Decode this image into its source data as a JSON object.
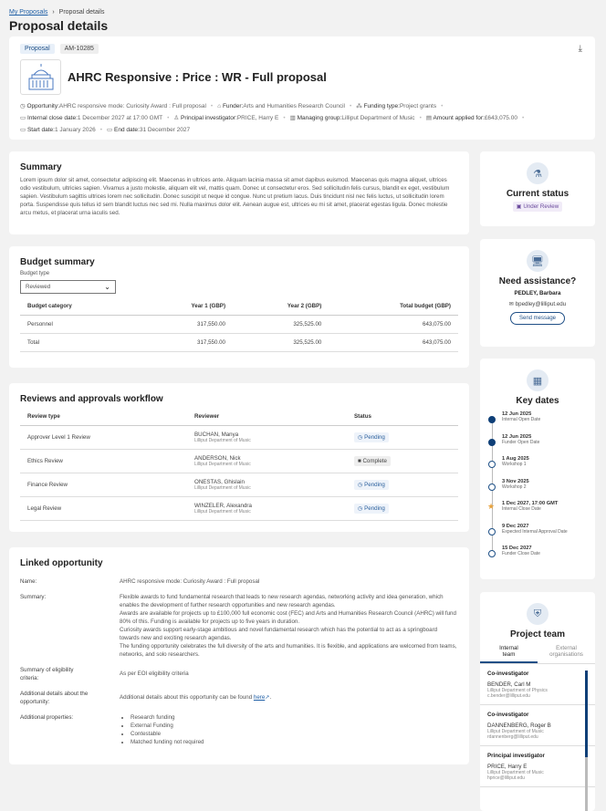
{
  "breadcrumb": {
    "link": "My Proposals",
    "sep": "›",
    "current": "Proposal details"
  },
  "page_title": "Proposal details",
  "header": {
    "type_chip": "Proposal",
    "id_chip": "AM-10285",
    "title": "AHRC Responsive : Price : WR - Full proposal",
    "meta": [
      {
        "icon": "clock-icon",
        "label": "Opportunity:",
        "value": "AHRC responsive mode: Curiosity Award : Full proposal"
      },
      {
        "icon": "bank-icon",
        "label": "Funder:",
        "value": "Arts and Humanities Research Council"
      },
      {
        "icon": "sitemap-icon",
        "label": "Funding type:",
        "value": "Project grants"
      },
      {
        "icon": "calendar-icon",
        "label": "Internal close date:",
        "value": "1 December 2027 at 17:00 GMT"
      },
      {
        "icon": "person-icon",
        "label": "Principal investigator:",
        "value": "PRICE, Harry E"
      },
      {
        "icon": "building-icon",
        "label": "Managing group:",
        "value": "Lilliput Department of Music"
      },
      {
        "icon": "money-icon",
        "label": "Amount applied for:",
        "value": "£643,075.00"
      },
      {
        "icon": "calendar-icon",
        "label": "Start date:",
        "value": "1 January 2026"
      },
      {
        "icon": "calendar-icon",
        "label": "End date:",
        "value": "31 December 2027"
      }
    ]
  },
  "summary": {
    "title": "Summary",
    "text": "Lorem ipsum dolor sit amet, consectetur adipiscing elit. Maecenas in ultrices ante. Aliquam lacinia massa sit amet dapibus euismod. Maecenas quis magna aliquet, ultrices odio vestibulum, ultricies sapien. Vivamus a justo molestie, aliquam elit vel, mattis quam. Donec ut consectetur eros. Sed sollicitudin felis cursus, blandit ex eget, vestibulum sapien. Vestibulum sagittis ultrices lorem nec sollicitudin. Donec suscipit ut neque id congue. Nunc ut pretium lacus. Duis tincidunt nisl nec felis luctus, ut sollicitudin lorem porta. Suspendisse quis tellus id sem blandit luctus nec sed mi. Nulla maximus dolor elit. Aenean augue est, ultrices eu mi sit amet, placerat egestas ligula. Donec molestie arcu metus, et placerat urna iaculis sed."
  },
  "budget": {
    "title": "Budget summary",
    "type_label": "Budget type",
    "type_value": "Reviewed",
    "headers": [
      "Budget category",
      "Year 1 (GBP)",
      "Year 2 (GBP)",
      "Total budget (GBP)"
    ],
    "rows": [
      [
        "Personnel",
        "317,550.00",
        "325,525.00",
        "643,075.00"
      ],
      [
        "Total",
        "317,550.00",
        "325,525.00",
        "643,075.00"
      ]
    ]
  },
  "reviews": {
    "title": "Reviews and approvals workflow",
    "headers": [
      "Review type",
      "Reviewer",
      "Status"
    ],
    "rows": [
      {
        "type": "Approver Level 1 Review",
        "name": "BUCHAN, Manya",
        "dept": "Lilliput Department of Music",
        "status": "Pending"
      },
      {
        "type": "Ethics Review",
        "name": "ANDERSON, Nick",
        "dept": "Lilliput Department of Music",
        "status": "Complete"
      },
      {
        "type": "Finance Review",
        "name": "ONESTAS, Ghislain",
        "dept": "Lilliput Department of Music",
        "status": "Pending"
      },
      {
        "type": "Legal Review",
        "name": "WINZELER, Alexandra",
        "dept": "Lilliput Department of Music",
        "status": "Pending"
      }
    ]
  },
  "linked": {
    "title": "Linked opportunity",
    "name_label": "Name:",
    "name": "AHRC responsive mode: Curiosity Award : Full proposal",
    "summary_label": "Summary:",
    "summary": [
      "Flexible awards to fund fundamental research that leads to new research agendas, networking activity and idea generation, which enables the development of further research opportunities and new research agendas.",
      "Awards are available for projects up to £100,000 full economic cost (FEC) and Arts and Humanities Research Council (AHRC) will fund 80% of this. Funding is available for projects up to five years in duration.",
      "Curiosity awards support early-stage ambitious and novel fundamental research which has the potential to act as a springboard towards new and exciting research agendas.",
      "The funding opportunity celebrates the full diversity of the arts and humanities. It is flexible, and applications are welcomed from teams, networks, and solo researchers."
    ],
    "elig_label": "Summary of eligibility criteria:",
    "elig": "As per EOI eligibility criteria",
    "add_label": "Additional details about the opportunity:",
    "add_text": "Additional details about this opportunity can be found ",
    "add_link": "here",
    "add_end": ".",
    "props_label": "Additional properties:",
    "props": [
      "Research funding",
      "External Funding",
      "Contestable",
      "Matched funding not required"
    ]
  },
  "status": {
    "title": "Current status",
    "value": "Under Review"
  },
  "assist": {
    "title": "Need assistance?",
    "name": "PEDLEY, Barbara",
    "email": "bpedley@lilliput.edu",
    "button": "Send message"
  },
  "key_dates": {
    "title": "Key dates",
    "items": [
      {
        "date": "12 Jun 2025",
        "label": "Internal Open Date",
        "state": "done"
      },
      {
        "date": "12 Jun 2025",
        "label": "Funder Open Date",
        "state": "done"
      },
      {
        "date": "1 Aug 2025",
        "label": "Workshop 1",
        "state": "open"
      },
      {
        "date": "3 Nov 2025",
        "label": "Workshop 2",
        "state": "open"
      },
      {
        "date": "1 Dec 2027, 17:00 GMT",
        "label": "Internal Close Date",
        "state": "star"
      },
      {
        "date": "9 Dec 2027",
        "label": "Expected Internal Approval Date",
        "state": "open"
      },
      {
        "date": "15 Dec 2027",
        "label": "Funder Close Date",
        "state": "open"
      }
    ]
  },
  "team": {
    "title": "Project team",
    "tabs": [
      "Internal team",
      "External organisations"
    ],
    "members": [
      {
        "role": "Co-investigator",
        "name": "BENDER, Carl M",
        "dept": "Lilliput Department of Physics",
        "email": "c.bender@lilliput.edu"
      },
      {
        "role": "Co-investigator",
        "name": "DANNENBERG, Roger B",
        "dept": "Lilliput Department of Music",
        "email": "rdannenberg@lilliput.edu"
      },
      {
        "role": "Principal investigator",
        "name": "PRICE, Harry E",
        "dept": "Lilliput Department of Music",
        "email": "hprice@lilliput.edu"
      }
    ]
  }
}
